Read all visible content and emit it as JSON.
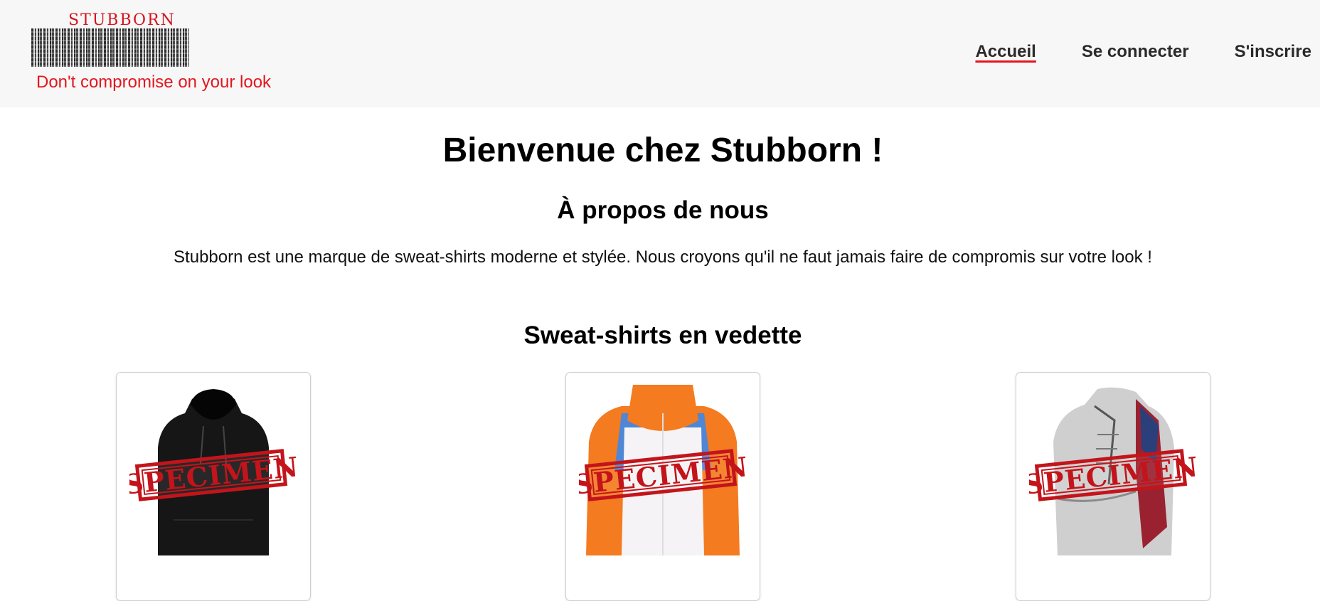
{
  "brand": {
    "logo_text": "STUBBORN",
    "tagline": "Don't compromise on your look",
    "accent_color": "#e3161d"
  },
  "nav": {
    "items": [
      {
        "label": "Accueil",
        "active": true
      },
      {
        "label": "Se connecter",
        "active": false
      },
      {
        "label": "S'inscrire",
        "active": false
      }
    ]
  },
  "main": {
    "title": "Bienvenue chez Stubborn !",
    "about_title": "À propos de nous",
    "about_text": "Stubborn est une marque de sweat-shirts moderne et stylée. Nous croyons qu'il ne faut jamais faire de compromis sur votre look !",
    "featured_title": "Sweat-shirts en vedette"
  },
  "products": [
    {
      "image": "black-hoodie",
      "stamp": "SPECIMEN"
    },
    {
      "image": "orange-white-blue-hoodie",
      "stamp": "SPECIMEN"
    },
    {
      "image": "grey-flag-hoodie",
      "stamp": "SPECIMEN"
    }
  ]
}
